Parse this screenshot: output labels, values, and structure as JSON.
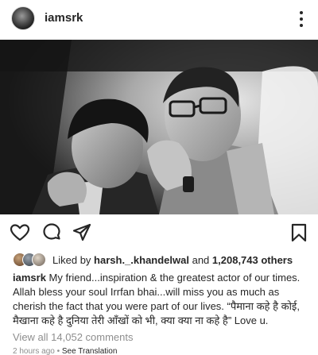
{
  "post": {
    "username": "iamsrk",
    "more_icon": "more-vertical-icon"
  },
  "actions": {
    "like_icon": "heart-icon",
    "comment_icon": "comment-icon",
    "share_icon": "share-icon",
    "save_icon": "bookmark-icon"
  },
  "likes": {
    "prefix": "Liked by ",
    "user": "harsh._.khandelwal",
    "connector": " and ",
    "count": "1,208,743 others"
  },
  "caption": {
    "author": "iamsrk",
    "text": " My friend...inspiration & the greatest actor of our times. Allah bless your soul Irrfan bhai...will miss you as much as cherish the fact that you were part of our lives. “पैमाना कहे है कोई, मैखाना कहे है दुनिया तेरी आँखों को भी, क्या क्या ना कहे है” Love u."
  },
  "comments": {
    "view_all": "View all 14,052 comments"
  },
  "meta": {
    "time_ago": "2 hours ago",
    "separator": " • ",
    "translation": "See Translation"
  }
}
